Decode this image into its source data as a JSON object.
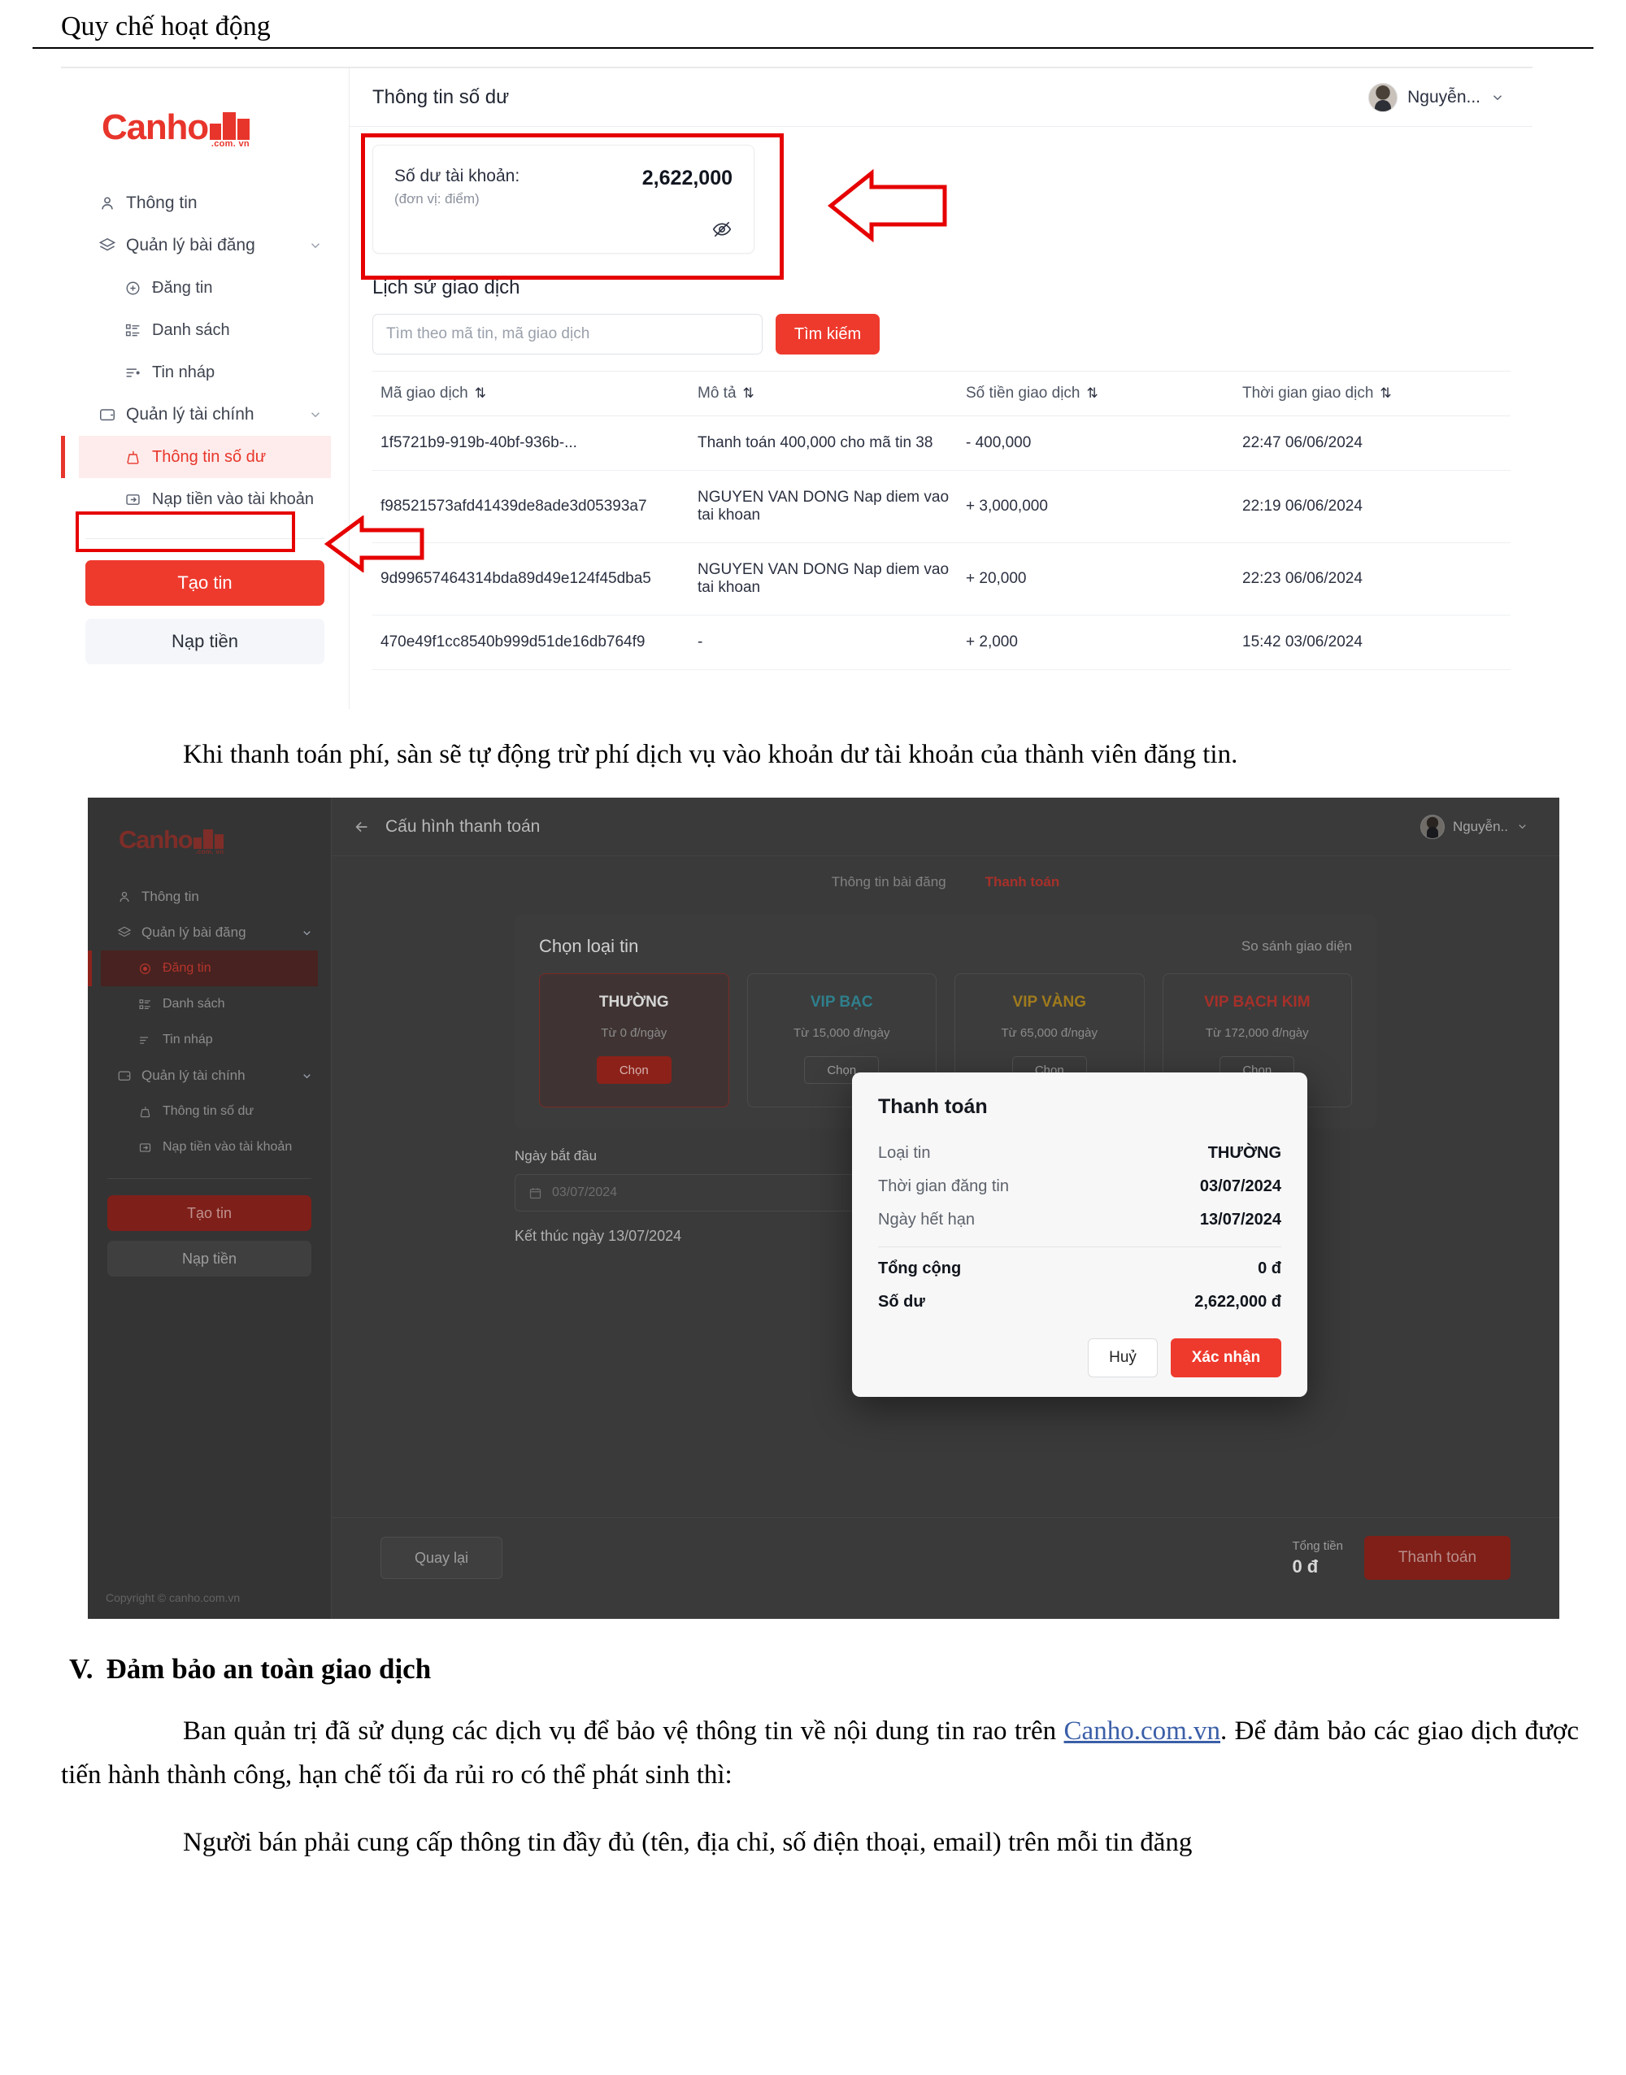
{
  "document": {
    "running_head": "Quy chế hoạt động",
    "paragraph_1": "Khi thanh toán phí, sàn sẽ tự động trừ phí dịch vụ vào khoản dư tài khoản của thành viên đăng tin.",
    "section_number": "V.",
    "section_title": "Đảm bảo an toàn giao dịch",
    "paragraph_2_a": "Ban quản trị đã sử dụng các dịch vụ để bảo vệ thông tin về nội dung tin rao trên ",
    "paragraph_2_link": "Canho.com.vn",
    "paragraph_2_b": ". Để đảm bảo các giao dịch được tiến hành thành công, hạn chế tối đa rủi ro có thể phát sinh thì:",
    "paragraph_3": "Người bán phải cung cấp thông tin đầy đủ (tên, địa chỉ, số điện thoại, email) trên mỗi tin đăng"
  },
  "colors": {
    "brand_red": "#e8352b",
    "button_red": "#ee3a2d",
    "annotation_red": "#e60000",
    "positive_green": "#1da462",
    "negative_red": "#e8352b",
    "link_blue": "#3b5fa8"
  },
  "shot1": {
    "logo": {
      "word": "Canho",
      "tld": ".com. vn"
    },
    "sidebar": {
      "items": [
        {
          "label": "Thông tin",
          "icon": "user-icon",
          "level": 0,
          "chevron": false,
          "active": false
        },
        {
          "label": "Quản lý bài đăng",
          "icon": "layers-icon",
          "level": 0,
          "chevron": true,
          "active": false
        },
        {
          "label": "Đăng tin",
          "icon": "plus-circle-icon",
          "level": 1,
          "chevron": false,
          "active": false
        },
        {
          "label": "Danh sách",
          "icon": "list-icon",
          "level": 1,
          "chevron": false,
          "active": false
        },
        {
          "label": "Tin nháp",
          "icon": "draft-icon",
          "level": 1,
          "chevron": false,
          "active": false
        },
        {
          "label": "Quản lý tài chính",
          "icon": "wallet-icon",
          "level": 0,
          "chevron": true,
          "active": false
        },
        {
          "label": "Thông tin số dư",
          "icon": "balance-icon",
          "level": 1,
          "chevron": false,
          "active": true
        },
        {
          "label": "Nạp tiền vào tài khoản",
          "icon": "deposit-icon",
          "level": 1,
          "chevron": false,
          "active": false
        }
      ],
      "create_button": "Tạo tin",
      "deposit_button": "Nạp tiền"
    },
    "topbar": {
      "title": "Thông tin số dư",
      "user_name": "Nguyễn...",
      "chevron": "chevron-down-icon"
    },
    "balance_card": {
      "label": "Số dư tài khoản:",
      "unit": "(đơn vị: điểm)",
      "amount": "2,622,000",
      "eye_icon": "eye-off-icon"
    },
    "history": {
      "title": "Lịch sử giao dịch",
      "search_placeholder": "Tìm theo mã tin, mã giao dịch",
      "search_value": "",
      "search_button": "Tìm kiếm",
      "columns": [
        "Mã giao dịch",
        "Mô tả",
        "Số tiền giao dịch",
        "Thời gian giao dịch"
      ],
      "sort_icon": "sort-arrows-icon",
      "rows": [
        {
          "code": "1f5721b9-919b-40bf-936b-...",
          "desc": "Thanh toán 400,000 cho mã tin 38",
          "amount": "- 400,000",
          "sign": "neg",
          "time": "22:47 06/06/2024"
        },
        {
          "code": "f98521573afd41439de8ade3d05393a7",
          "desc": "NGUYEN VAN DONG Nap diem vao tai khoan",
          "amount": "+ 3,000,000",
          "sign": "pos",
          "time": "22:19 06/06/2024"
        },
        {
          "code": "9d99657464314bda89d49e124f45dba5",
          "desc": "NGUYEN VAN DONG Nap diem vao tai khoan",
          "amount": "+ 20,000",
          "sign": "pos",
          "time": "22:23 06/06/2024"
        },
        {
          "code": "470e49f1cc8540b999d51de16db764f9",
          "desc": "-",
          "amount": "+ 2,000",
          "sign": "pos",
          "time": "15:42 03/06/2024"
        }
      ]
    }
  },
  "shot2": {
    "logo": {
      "word": "Canho",
      "tld": ".com. vn"
    },
    "sidebar": {
      "items": [
        {
          "label": "Thông tin",
          "icon": "user-icon",
          "level": 0,
          "chevron": false,
          "active": false
        },
        {
          "label": "Quản lý bài đăng",
          "icon": "layers-icon",
          "level": 0,
          "chevron": true,
          "active": false
        },
        {
          "label": "Đăng tin",
          "icon": "plus-circle-icon",
          "level": 1,
          "chevron": false,
          "active": true
        },
        {
          "label": "Danh sách",
          "icon": "list-icon",
          "level": 1,
          "chevron": false,
          "active": false
        },
        {
          "label": "Tin nháp",
          "icon": "draft-icon",
          "level": 1,
          "chevron": false,
          "active": false
        },
        {
          "label": "Quản lý tài chính",
          "icon": "wallet-icon",
          "level": 0,
          "chevron": true,
          "active": false
        },
        {
          "label": "Thông tin số dư",
          "icon": "balance-icon",
          "level": 1,
          "chevron": false,
          "active": false
        },
        {
          "label": "Nạp tiền vào tài khoản",
          "icon": "deposit-icon",
          "level": 1,
          "chevron": false,
          "active": false
        }
      ],
      "create_button": "Tạo tin",
      "deposit_button": "Nạp tiền",
      "copyright": "Copyright © canho.com.vn"
    },
    "topbar": {
      "back_icon": "arrow-left-icon",
      "title": "Cấu hình thanh toán",
      "user_name": "Nguyễn..",
      "chevron": "chevron-down-icon"
    },
    "tabs": [
      {
        "label": "Thông tin bài đăng",
        "active": false
      },
      {
        "label": "Thanh toán",
        "active": true
      }
    ],
    "type_section": {
      "title": "Chọn loại tin",
      "compare_link": "So sánh giao diện",
      "tiers": [
        {
          "name": "THƯỜNG",
          "price": "Từ 0 đ/ngày",
          "button": "Chọn",
          "selected": true
        },
        {
          "name": "VIP BẠC",
          "price": "Từ 15,000 đ/ngày",
          "button": "Chọn",
          "selected": false
        },
        {
          "name": "VIP VÀNG",
          "price": "Từ 65,000 đ/ngày",
          "button": "Chọn",
          "selected": false
        },
        {
          "name": "VIP BẠCH KIM",
          "price": "Từ 172,000 đ/ngày",
          "button": "Chọn",
          "selected": false
        }
      ]
    },
    "date_section": {
      "label": "Ngày bắt đầu",
      "calendar_icon": "calendar-icon",
      "value": "03/07/2024",
      "end_note": "Kết thúc ngày 13/07/2024"
    },
    "footer": {
      "back_button": "Quay lại",
      "total_label": "Tổng tiền",
      "total_value": "0 đ",
      "pay_button": "Thanh toán"
    },
    "modal": {
      "title": "Thanh toán",
      "rows": [
        {
          "key": "Loại tin",
          "value": "THƯỜNG",
          "strong": false
        },
        {
          "key": "Thời gian đăng tin",
          "value": "03/07/2024",
          "strong": false
        },
        {
          "key": "Ngày hết hạn",
          "value": "13/07/2024",
          "strong": false
        }
      ],
      "total_rows": [
        {
          "key": "Tổng cộng",
          "value": "0 đ",
          "strong": true
        },
        {
          "key": "Số dư",
          "value": "2,622,000 đ",
          "strong": true
        }
      ],
      "cancel_button": "Huỷ",
      "confirm_button": "Xác nhận"
    }
  }
}
